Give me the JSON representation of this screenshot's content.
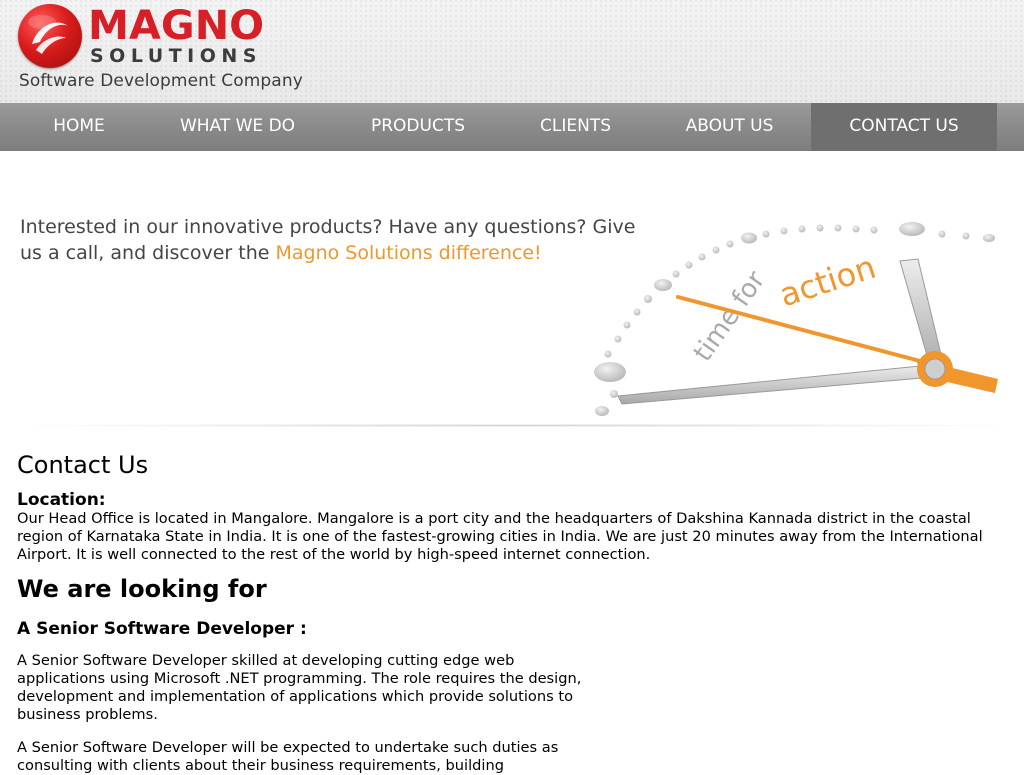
{
  "header": {
    "brand_name": "MAGNO",
    "brand_sub": "SOLUTIONS",
    "tagline": "Software Development Company"
  },
  "nav": {
    "items": [
      {
        "label": "HOME"
      },
      {
        "label": "WHAT WE DO"
      },
      {
        "label": "PRODUCTS"
      },
      {
        "label": "CLIENTS"
      },
      {
        "label": "ABOUT US"
      },
      {
        "label": "CONTACT US",
        "active": true
      }
    ]
  },
  "banner": {
    "text_before": "Interested in our innovative products? Have any questions? Give us a call, and discover the ",
    "highlight": "Magno Solutions difference!",
    "clock_text": "time for action"
  },
  "content": {
    "title": "Contact Us",
    "location_label": "Location:",
    "location_text": "Our Head Office is located in Mangalore. Mangalore is a port city and the headquarters of Dakshina Kannada district in the coastal region of Karnataka State in India. It is one of the fastest-growing cities in India. We are just 20 minutes away from the International Airport. It is well connected to the rest of the world by high-speed internet connection.",
    "looking_title": "We are looking for",
    "job_title": "A Senior Software Developer :",
    "job_p1": "A Senior Software Developer skilled at developing cutting edge web applications using Microsoft .NET programming. The role requires the design, development and implementation of applications which provide solutions to business problems.",
    "job_p2": "A Senior Software Developer will be expected to undertake such duties as consulting with clients about their business requirements, building"
  },
  "colors": {
    "brand_red": "#d61f26",
    "accent_orange": "#f0962d",
    "nav_bg": "#8a8a8a",
    "nav_active": "#6f6f6f"
  }
}
